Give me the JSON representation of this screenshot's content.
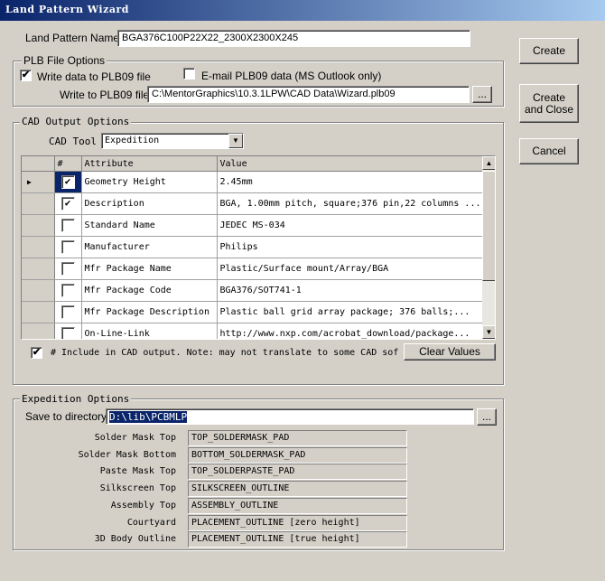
{
  "window": {
    "title": "Land Pattern Wizard"
  },
  "land_pattern_name": {
    "label": "Land Pattern Name",
    "value": "BGA376C100P22X22_2300X2300X245"
  },
  "plb_options": {
    "title": "PLB File Options",
    "write_data": {
      "label": "Write data to PLB09 file",
      "checked": true
    },
    "email": {
      "label": "E-mail PLB09 data  (MS Outlook only)",
      "checked": false
    },
    "write_to_label": "Write to PLB09 file",
    "write_to_value": "C:\\MentorGraphics\\10.3.1LPW\\CAD Data\\Wizard.plb09",
    "browse_label": "..."
  },
  "buttons": {
    "create": "Create",
    "create_close_line1": "Create",
    "create_close_line2": "and Close",
    "cancel": "Cancel"
  },
  "cad_output": {
    "title": "CAD Output Options",
    "cad_tool_label": "CAD Tool",
    "cad_tool_value": "Expedition",
    "columns": [
      "#",
      "Attribute",
      "Value"
    ],
    "rows": [
      {
        "checked": true,
        "attribute": "Geometry Height",
        "value": "2.45mm",
        "current": true
      },
      {
        "checked": true,
        "attribute": "Description",
        "value": "BGA, 1.00mm pitch, square;376 pin,22 columns ...",
        "current": false
      },
      {
        "checked": false,
        "attribute": "Standard Name",
        "value": "JEDEC MS-034",
        "current": false
      },
      {
        "checked": false,
        "attribute": "Manufacturer",
        "value": "Philips",
        "current": false
      },
      {
        "checked": false,
        "attribute": "Mfr Package Name",
        "value": "Plastic/Surface mount/Array/BGA",
        "current": false
      },
      {
        "checked": false,
        "attribute": "Mfr Package Code",
        "value": "BGA376/SOT741-1",
        "current": false
      },
      {
        "checked": false,
        "attribute": "Mfr Package Description",
        "value": "Plastic ball grid array package; 376 balls;...",
        "current": false
      },
      {
        "checked": false,
        "attribute": "On-Line-Link",
        "value": "http://www.nxp.com/acrobat_download/package...",
        "current": false
      }
    ],
    "include_label": "# Include in CAD output.  Note: may not translate to some CAD sof",
    "include_checked": true,
    "clear_values": "Clear Values"
  },
  "expedition": {
    "title": "Expedition Options",
    "save_label": "Save to directory",
    "save_value": "D:\\lib\\PCBMLP",
    "browse_label": "...",
    "layers": [
      {
        "label": "Solder Mask Top",
        "value": "TOP_SOLDERMASK_PAD"
      },
      {
        "label": "Solder Mask Bottom",
        "value": "BOTTOM_SOLDERMASK_PAD"
      },
      {
        "label": "Paste Mask Top",
        "value": "TOP_SOLDERPASTE_PAD"
      },
      {
        "label": "Silkscreen Top",
        "value": "SILKSCREEN_OUTLINE"
      },
      {
        "label": "Assembly Top",
        "value": "ASSEMBLY_OUTLINE"
      },
      {
        "label": "Courtyard",
        "value": "PLACEMENT_OUTLINE [zero height]"
      },
      {
        "label": "3D Body Outline",
        "value": "PLACEMENT_OUTLINE [true height]"
      }
    ]
  }
}
